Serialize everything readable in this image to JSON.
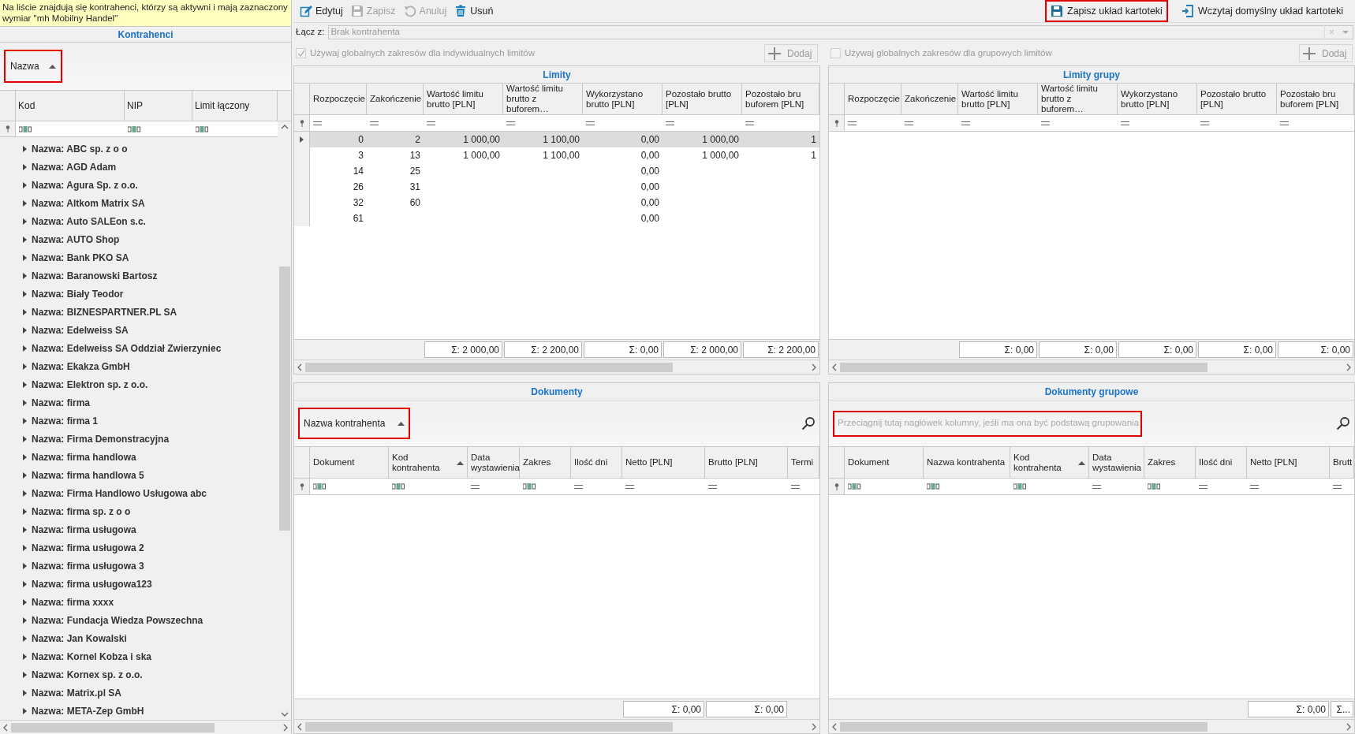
{
  "notice": "Na liście znajdują się kontrahenci, którzy są aktywni i mają zaznaczony wymiar \"mh Mobilny Handel\"",
  "contractors": {
    "title": "Kontrahenci",
    "group_by": {
      "label": "Nazwa",
      "highlighted": true
    },
    "columns": [
      {
        "label": "Kod",
        "kind": "text"
      },
      {
        "label": "NIP",
        "kind": "text"
      },
      {
        "label": "Limit łączony",
        "kind": "text"
      }
    ],
    "groups": [
      {
        "label": "Nazwa: ABC sp. z o o",
        "expanded": false
      },
      {
        "label": "Nazwa: AGD Adam",
        "expanded": false
      },
      {
        "label": "Nazwa: Agura Sp. z o.o.",
        "expanded": false
      },
      {
        "label": "Nazwa: Altkom Matrix SA",
        "expanded": false
      },
      {
        "label": "Nazwa: Auto SALEon s.c.",
        "expanded": false
      },
      {
        "label": "Nazwa: AUTO Shop",
        "expanded": false
      },
      {
        "label": "Nazwa: Bank PKO SA",
        "expanded": false
      },
      {
        "label": "Nazwa: Baranowski Bartosz",
        "expanded": false
      },
      {
        "label": "Nazwa: Biały Teodor",
        "expanded": false
      },
      {
        "label": "Nazwa: BIZNESPARTNER.PL SA",
        "expanded": false
      },
      {
        "label": "Nazwa: Edelweiss SA",
        "expanded": false
      },
      {
        "label": "Nazwa: Edelweiss SA Oddział Zwierzyniec",
        "expanded": false
      },
      {
        "label": "Nazwa: Ekakza GmbH",
        "expanded": false
      },
      {
        "label": "Nazwa: Elektron sp. z o.o.",
        "expanded": false
      },
      {
        "label": "Nazwa: firma",
        "expanded": false
      },
      {
        "label": "Nazwa: firma 1",
        "expanded": false
      },
      {
        "label": "Nazwa: Firma Demonstracyjna",
        "expanded": false
      },
      {
        "label": "Nazwa: firma handlowa",
        "expanded": false
      },
      {
        "label": "Nazwa: firma handlowa 5",
        "expanded": false
      },
      {
        "label": "Nazwa: Firma Handlowo Usługowa abc",
        "expanded": false
      },
      {
        "label": "Nazwa: firma sp. z o o",
        "expanded": false
      },
      {
        "label": "Nazwa: firma usługowa",
        "expanded": false
      },
      {
        "label": "Nazwa: firma usługowa 2",
        "expanded": false
      },
      {
        "label": "Nazwa: firma usługowa 3",
        "expanded": false
      },
      {
        "label": "Nazwa: firma usługowa123",
        "expanded": false
      },
      {
        "label": "Nazwa: firma xxxx",
        "expanded": false
      },
      {
        "label": "Nazwa: Fundacja Wiedza Powszechna",
        "expanded": false
      },
      {
        "label": "Nazwa: Jan Kowalski",
        "expanded": false
      },
      {
        "label": "Nazwa: Kornel Kobza i ska",
        "expanded": false
      },
      {
        "label": "Nazwa: Kornex sp. z o.o.",
        "expanded": false
      },
      {
        "label": "Nazwa: Matrix.pl SA",
        "expanded": false
      },
      {
        "label": "Nazwa: META-Zep GmbH",
        "expanded": false
      }
    ]
  },
  "toolbar": {
    "left": [
      {
        "label": "Edytuj",
        "disabled": false
      },
      {
        "label": "Zapisz",
        "disabled": true
      },
      {
        "label": "Anuluj",
        "disabled": true
      },
      {
        "label": "Usuń",
        "disabled": false
      }
    ],
    "right": [
      {
        "label": "Zapisz układ kartoteki",
        "highlighted": true
      },
      {
        "label": "Wczytaj domyślny układ kartoteki",
        "highlighted": false
      }
    ]
  },
  "link_field": {
    "label": "Łącz z:",
    "placeholder": "Brak kontrahenta",
    "clear": "×"
  },
  "panels": [
    {
      "checkbox": {
        "label": "Używaj globalnych zakresów dla indywidualnych limitów",
        "checked": true,
        "disabled": true
      },
      "add_button": {
        "label": "Dodaj",
        "disabled": true
      },
      "title": "Limity",
      "columns": [
        {
          "label": "Rozpoczęcie",
          "kind": "number"
        },
        {
          "label": "Zakończenie",
          "kind": "number"
        },
        {
          "label": "Wartość limitu brutto [PLN]",
          "kind": "number"
        },
        {
          "label": "Wartość limitu brutto z buforem…",
          "kind": "number"
        },
        {
          "label": "Wykorzystano brutto [PLN]",
          "kind": "number"
        },
        {
          "label": "Pozostało brutto [PLN]",
          "kind": "number"
        },
        {
          "label": "Pozostało bru buforem [PLN]",
          "kind": "number"
        }
      ],
      "rows": [
        {
          "selected": true,
          "cells": [
            "0",
            "2",
            "1 000,00",
            "1 100,00",
            "0,00",
            "1 000,00",
            "1"
          ]
        },
        {
          "selected": false,
          "cells": [
            "3",
            "13",
            "1 000,00",
            "1 100,00",
            "0,00",
            "1 000,00",
            "1"
          ]
        },
        {
          "selected": false,
          "cells": [
            "14",
            "25",
            "",
            "",
            "0,00",
            "",
            ""
          ]
        },
        {
          "selected": false,
          "cells": [
            "26",
            "31",
            "",
            "",
            "0,00",
            "",
            ""
          ]
        },
        {
          "selected": false,
          "cells": [
            "32",
            "60",
            "",
            "",
            "0,00",
            "",
            ""
          ]
        },
        {
          "selected": false,
          "cells": [
            "61",
            "",
            "",
            "",
            "0,00",
            "",
            ""
          ]
        }
      ],
      "sums": [
        "Σ: 2 000,00",
        "Σ: 2 200,00",
        "Σ: 0,00",
        "Σ: 2 000,00",
        "Σ: 2 200,00"
      ]
    },
    {
      "checkbox": {
        "label": "Używaj globalnych zakresów dla grupowych limitów",
        "checked": false,
        "disabled": true
      },
      "add_button": {
        "label": "Dodaj",
        "disabled": true
      },
      "title": "Limity grupy",
      "columns": [
        {
          "label": "Rozpoczęcie",
          "kind": "number"
        },
        {
          "label": "Zakończenie",
          "kind": "number"
        },
        {
          "label": "Wartość limitu brutto [PLN]",
          "kind": "number"
        },
        {
          "label": "Wartość limitu brutto z buforem…",
          "kind": "number"
        },
        {
          "label": "Wykorzystano brutto [PLN]",
          "kind": "number"
        },
        {
          "label": "Pozostało brutto [PLN]",
          "kind": "number"
        },
        {
          "label": "Pozostało bru buforem [PLN]",
          "kind": "number"
        }
      ],
      "sums": [
        "Σ: 0,00",
        "Σ: 0,00",
        "Σ: 0,00",
        "Σ: 0,00",
        "Σ: 0,00"
      ]
    },
    {
      "title": "Dokumenty",
      "group_by": {
        "label": "Nazwa kontrahenta",
        "highlighted": true
      },
      "columns": [
        {
          "label": "Dokument",
          "kind": "text",
          "sorted": false
        },
        {
          "label": "Kod kontrahenta",
          "kind": "text",
          "sorted": true
        },
        {
          "label": "Data wystawienia",
          "kind": "number",
          "sorted": false
        },
        {
          "label": "Zakres",
          "kind": "text",
          "sorted": false
        },
        {
          "label": "Ilość dni",
          "kind": "number",
          "sorted": false
        },
        {
          "label": "Netto [PLN]",
          "kind": "number",
          "sorted": false
        },
        {
          "label": "Brutto [PLN]",
          "kind": "number",
          "sorted": false
        },
        {
          "label": "Termi",
          "kind": "number",
          "sorted": false
        }
      ],
      "sums": [
        "Σ: 0,00",
        "Σ: 0,00"
      ]
    },
    {
      "title": "Dokumenty grupowe",
      "group_placeholder": {
        "label": "Przeciągnij tutaj nagłówek kolumny, jeśli ma ona być podstawą grupowania",
        "highlighted": true
      },
      "columns": [
        {
          "label": "Dokument",
          "kind": "text",
          "sorted": false
        },
        {
          "label": "Nazwa kontrahenta",
          "kind": "text",
          "sorted": false
        },
        {
          "label": "Kod kontrahenta",
          "kind": "text",
          "sorted": true
        },
        {
          "label": "Data wystawienia",
          "kind": "number",
          "sorted": false
        },
        {
          "label": "Zakres",
          "kind": "text",
          "sorted": false
        },
        {
          "label": "Ilość dni",
          "kind": "number",
          "sorted": false
        },
        {
          "label": "Netto [PLN]",
          "kind": "number",
          "sorted": false
        },
        {
          "label": "Brutt",
          "kind": "number",
          "sorted": false
        }
      ],
      "sums": [
        "Σ: 0,00",
        "Σ..."
      ]
    }
  ]
}
